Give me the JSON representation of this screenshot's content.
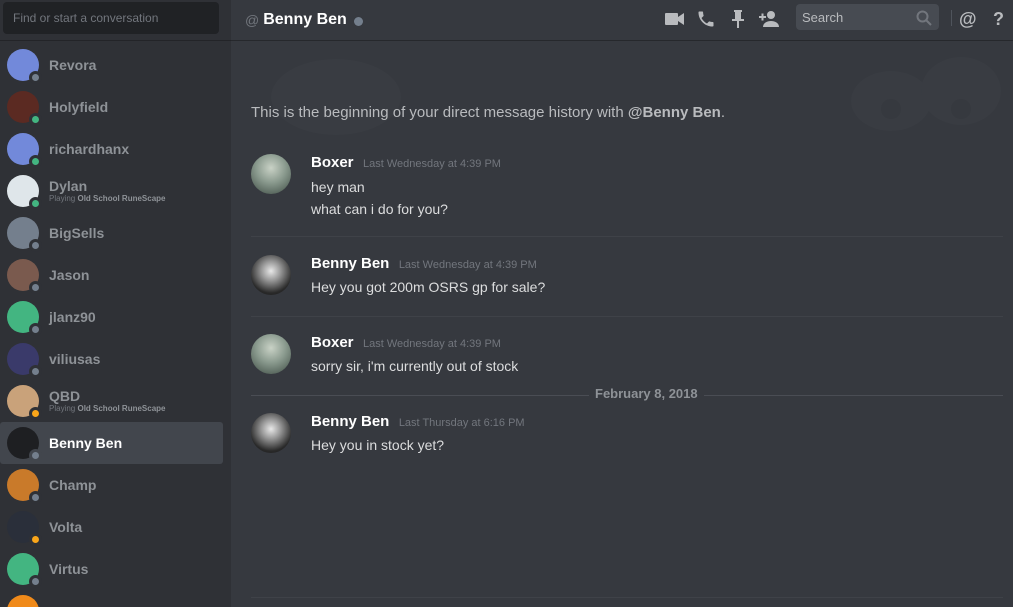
{
  "sidebar": {
    "search_placeholder": "Find or start a conversation",
    "dms": [
      {
        "name": "Revora",
        "status": "offline",
        "activity_prefix": "",
        "activity_game": "",
        "active": false,
        "avatar_color": "#7289da"
      },
      {
        "name": "Holyfield",
        "status": "online",
        "activity_prefix": "",
        "activity_game": "",
        "active": false,
        "avatar_color": "#5b2a22"
      },
      {
        "name": "richardhanx",
        "status": "online",
        "activity_prefix": "",
        "activity_game": "",
        "active": false,
        "avatar_color": "#7289da"
      },
      {
        "name": "Dylan",
        "status": "online",
        "activity_prefix": "Playing ",
        "activity_game": "Old School RuneScape",
        "active": false,
        "avatar_color": "#dfe6ea"
      },
      {
        "name": "BigSells",
        "status": "offline",
        "activity_prefix": "",
        "activity_game": "",
        "active": false,
        "avatar_color": "#747f8d"
      },
      {
        "name": "Jason",
        "status": "offline",
        "activity_prefix": "",
        "activity_game": "",
        "active": false,
        "avatar_color": "#7a5a4e"
      },
      {
        "name": "jlanz90",
        "status": "offline",
        "activity_prefix": "",
        "activity_game": "",
        "active": false,
        "avatar_color": "#43b581"
      },
      {
        "name": "viliusas",
        "status": "offline",
        "activity_prefix": "",
        "activity_game": "",
        "active": false,
        "avatar_color": "#3a3a6a"
      },
      {
        "name": "QBD",
        "status": "idle",
        "activity_prefix": "Playing ",
        "activity_game": "Old School RuneScape",
        "active": false,
        "avatar_color": "#c9a27a"
      },
      {
        "name": "Benny Ben",
        "status": "offline",
        "activity_prefix": "",
        "activity_game": "",
        "active": true,
        "avatar_color": "#1e1f22"
      },
      {
        "name": "Champ",
        "status": "offline",
        "activity_prefix": "",
        "activity_game": "",
        "active": false,
        "avatar_color": "#c97a2a"
      },
      {
        "name": "Volta",
        "status": "idle",
        "activity_prefix": "",
        "activity_game": "",
        "active": false,
        "avatar_color": "#2a2f3a"
      },
      {
        "name": "Virtus",
        "status": "offline",
        "activity_prefix": "",
        "activity_game": "",
        "active": false,
        "avatar_color": "#43b581"
      },
      {
        "name": "",
        "status": "offline",
        "activity_prefix": "",
        "activity_game": "",
        "active": false,
        "avatar_color": "#f08a1a"
      }
    ]
  },
  "header": {
    "at": "@",
    "title": "Benny Ben",
    "search_placeholder": "Search",
    "icons": [
      "video-call-icon",
      "voice-call-icon",
      "pin-icon",
      "add-friend-icon",
      "search-icon",
      "mention-icon",
      "help-icon"
    ]
  },
  "chat": {
    "intro_prefix": "This is the beginning of your direct message history with ",
    "intro_user": "@Benny Ben",
    "intro_suffix": ".",
    "messages": [
      {
        "author": "Boxer",
        "time": "Last Wednesday at 4:39 PM",
        "lines": [
          "hey man",
          "what can i do for you?"
        ]
      },
      {
        "author": "Benny Ben",
        "time": "Last Wednesday at 4:39 PM",
        "lines": [
          "Hey you got 200m OSRS gp for sale?"
        ]
      },
      {
        "author": "Boxer",
        "time": "Last Wednesday at 4:39 PM",
        "lines": [
          "sorry sir, i'm currently out of stock"
        ]
      },
      {
        "author": "Benny Ben",
        "time": "Last Thursday at 6:16 PM",
        "lines": [
          "Hey you in stock yet?"
        ]
      }
    ],
    "date_divider": "February 8, 2018"
  },
  "colors": {
    "sidebar_bg": "#2f3136",
    "chat_bg": "#36393f",
    "online": "#43b581",
    "idle": "#faa61a",
    "offline": "#747f8d"
  }
}
